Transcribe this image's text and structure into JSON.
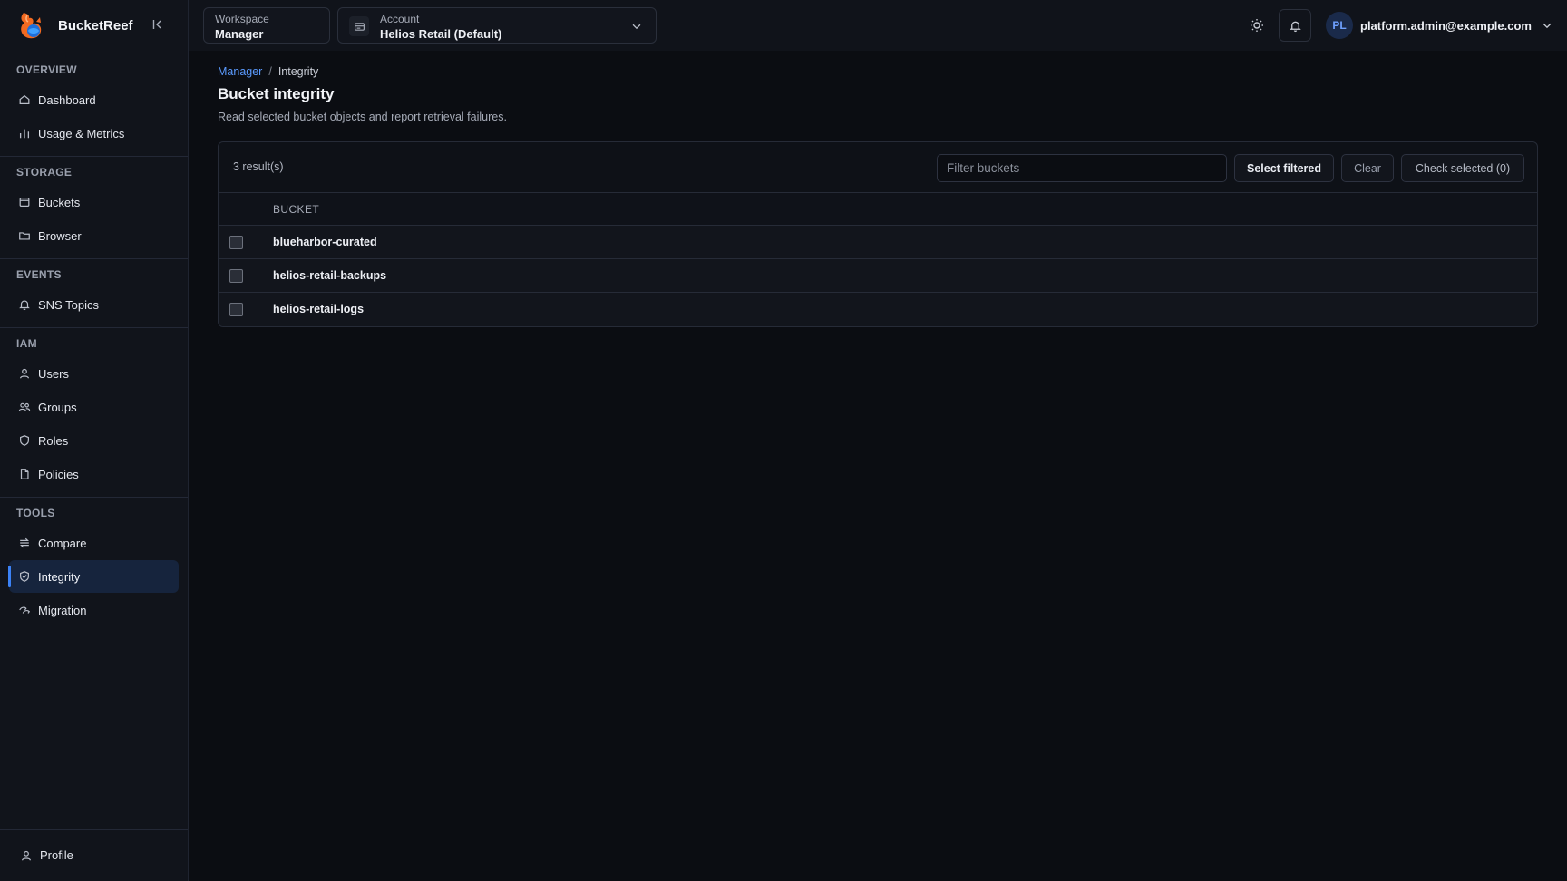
{
  "brand": {
    "name": "BucketReef"
  },
  "sidebar": {
    "sections": [
      {
        "title": "OVERVIEW",
        "items": [
          {
            "label": "Dashboard",
            "icon": "home-icon"
          },
          {
            "label": "Usage & Metrics",
            "icon": "bar-chart-icon"
          }
        ]
      },
      {
        "title": "STORAGE",
        "items": [
          {
            "label": "Buckets",
            "icon": "bucket-icon"
          },
          {
            "label": "Browser",
            "icon": "folder-icon"
          }
        ]
      },
      {
        "title": "EVENTS",
        "items": [
          {
            "label": "SNS Topics",
            "icon": "bell-icon"
          }
        ]
      },
      {
        "title": "IAM",
        "items": [
          {
            "label": "Users",
            "icon": "user-icon"
          },
          {
            "label": "Groups",
            "icon": "users-icon"
          },
          {
            "label": "Roles",
            "icon": "shield-icon"
          },
          {
            "label": "Policies",
            "icon": "file-icon"
          }
        ]
      },
      {
        "title": "TOOLS",
        "items": [
          {
            "label": "Compare",
            "icon": "compare-icon"
          },
          {
            "label": "Integrity",
            "icon": "shield-check-icon",
            "active": true
          },
          {
            "label": "Migration",
            "icon": "migration-icon"
          }
        ]
      }
    ],
    "footer": {
      "label": "Profile",
      "icon": "user-icon"
    }
  },
  "topbar": {
    "workspace": {
      "label": "Workspace",
      "value": "Manager"
    },
    "account": {
      "label": "Account",
      "value": "Helios Retail (Default)"
    },
    "user": {
      "initials": "PL",
      "email": "platform.admin@example.com"
    }
  },
  "breadcrumb": {
    "parent": "Manager",
    "separator": "/",
    "current": "Integrity"
  },
  "page": {
    "title": "Bucket integrity",
    "description": "Read selected bucket objects and report retrieval failures."
  },
  "panel": {
    "result_count": "3 result(s)",
    "filter_placeholder": "Filter buckets",
    "select_filtered_label": "Select filtered",
    "clear_label": "Clear",
    "check_selected_label": "Check selected (0)",
    "column_header": "BUCKET",
    "rows": [
      {
        "name": "blueharbor-curated"
      },
      {
        "name": "helios-retail-backups"
      },
      {
        "name": "helios-retail-logs"
      }
    ]
  },
  "colors": {
    "accent": "#3b82f6",
    "link": "#5b9bff",
    "background": "#0b0d12",
    "sidebar": "#11141b"
  }
}
